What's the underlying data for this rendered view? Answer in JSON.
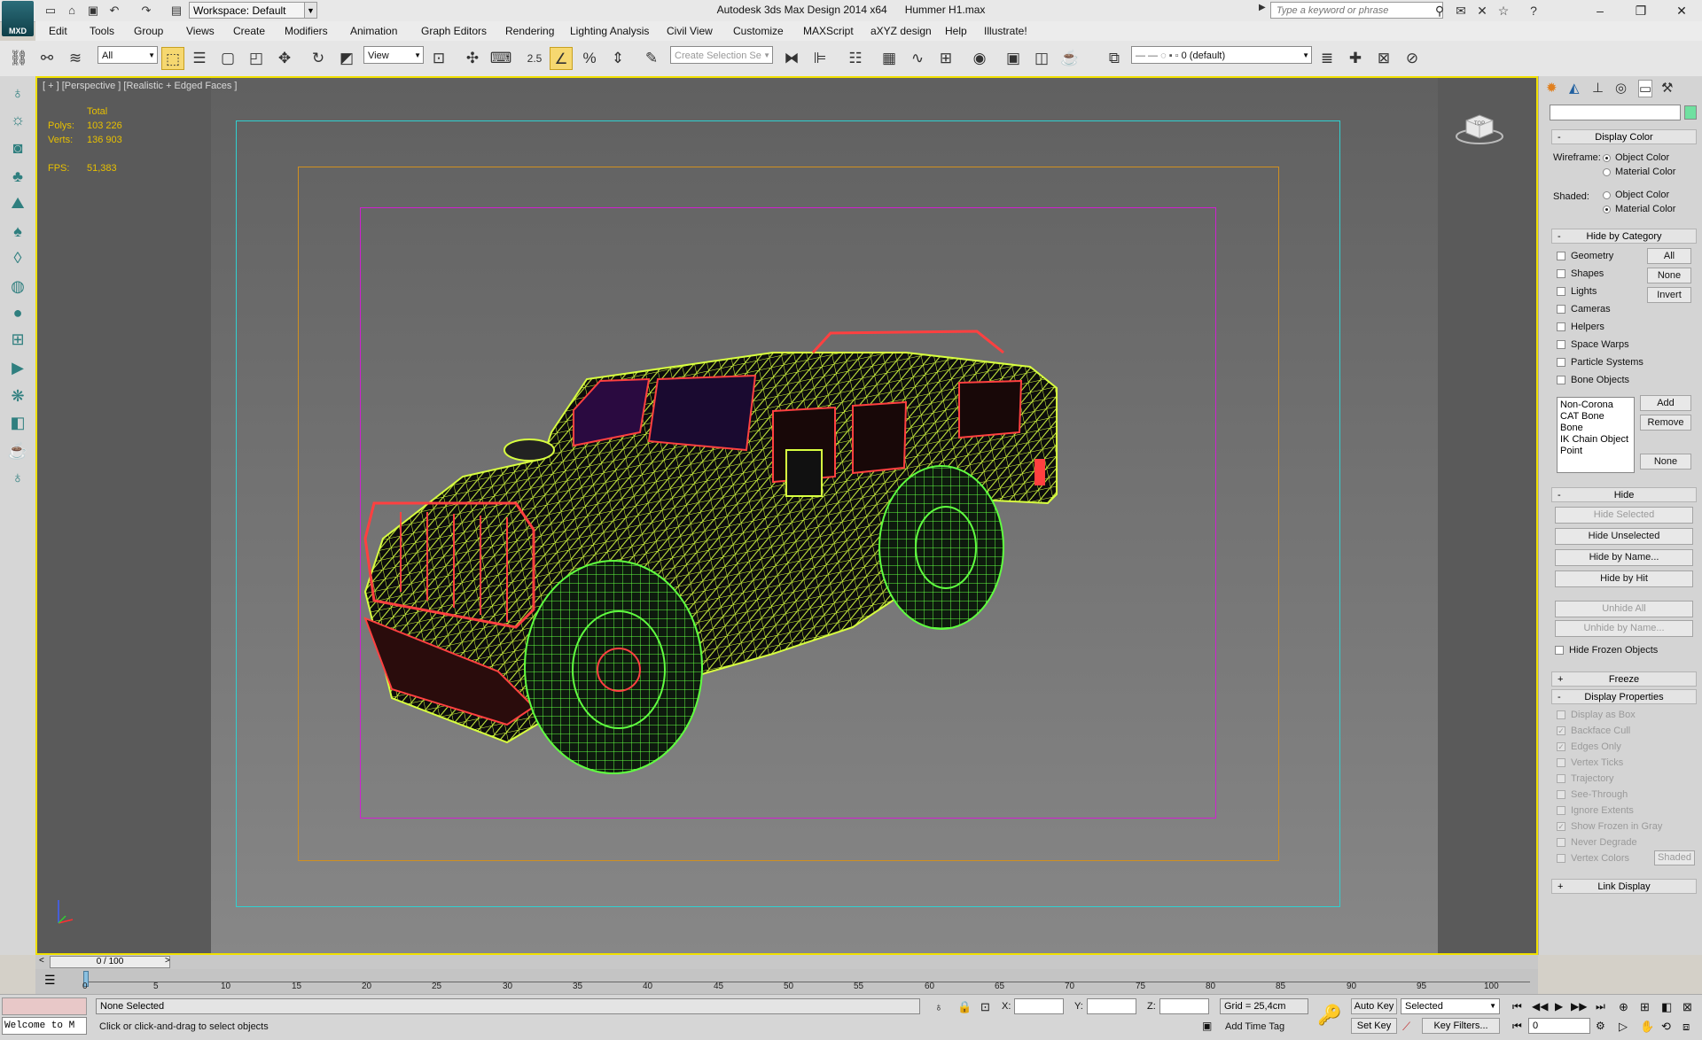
{
  "titlebar": {
    "logo_text": "MXD",
    "workspace_label": "Workspace: Default",
    "app_title": "Autodesk 3ds Max Design 2014 x64      Hummer H1.max",
    "search_placeholder": "Type a keyword or phrase"
  },
  "menus": [
    "Edit",
    "Tools",
    "Group",
    "Views",
    "Create",
    "Modifiers",
    "Animation",
    "Graph Editors",
    "Rendering",
    "Lighting Analysis",
    "Civil View",
    "Customize",
    "MAXScript",
    "aXYZ design",
    "Help",
    "Illustrate!"
  ],
  "toolbar": {
    "selection_filter": "All",
    "ref_coord": "View",
    "snap_value": "2.5",
    "named_selection_placeholder": "Create Selection Se",
    "layer_name": "0 (default)"
  },
  "viewport": {
    "label": "[ + ] [Perspective ] [Realistic + Edged Faces ]",
    "stats": {
      "total_label": "Total",
      "polys_label": "Polys:",
      "polys_value": "103 226",
      "verts_label": "Verts:",
      "verts_value": "136 903",
      "fps_label": "FPS:",
      "fps_value": "51,383"
    },
    "viewcube_text": "TOP"
  },
  "right_panel": {
    "display_color": {
      "header": "Display Color",
      "wireframe_label": "Wireframe:",
      "shaded_label": "Shaded:",
      "opt_object": "Object Color",
      "opt_material": "Material Color"
    },
    "hide_by_category": {
      "header": "Hide by Category",
      "items": [
        "Geometry",
        "Shapes",
        "Lights",
        "Cameras",
        "Helpers",
        "Space Warps",
        "Particle Systems",
        "Bone Objects"
      ],
      "btn_all": "All",
      "btn_none": "None",
      "btn_invert": "Invert",
      "list": [
        "Non-Corona",
        "CAT Bone",
        "Bone",
        "IK Chain Object",
        "Point"
      ],
      "btn_add": "Add",
      "btn_remove": "Remove",
      "btn_none2": "None"
    },
    "hide": {
      "header": "Hide",
      "hide_selected": "Hide Selected",
      "hide_unselected": "Hide Unselected",
      "hide_by_name": "Hide by Name...",
      "hide_by_hit": "Hide by Hit",
      "unhide_all": "Unhide All",
      "unhide_by_name": "Unhide by Name...",
      "hide_frozen": "Hide Frozen Objects"
    },
    "freeze_header": "Freeze",
    "display_properties": {
      "header": "Display Properties",
      "items": [
        "Display as Box",
        "Backface Cull",
        "Edges Only",
        "Vertex Ticks",
        "Trajectory",
        "See-Through",
        "Ignore Extents",
        "Show Frozen in Gray",
        "Never Degrade",
        "Vertex Colors"
      ],
      "checked": [
        false,
        true,
        true,
        false,
        false,
        false,
        false,
        true,
        false,
        false
      ],
      "shaded_btn": "Shaded"
    },
    "link_display_header": "Link Display"
  },
  "timeline": {
    "frame_counter": "0 / 100",
    "ticks": [
      "0",
      "5",
      "10",
      "15",
      "20",
      "25",
      "30",
      "35",
      "40",
      "45",
      "50",
      "55",
      "60",
      "65",
      "70",
      "75",
      "80",
      "85",
      "90",
      "95",
      "100"
    ]
  },
  "statusbar": {
    "listener_text": "Welcome to M",
    "selection_status": "None Selected",
    "prompt": "Click or click-and-drag to select objects",
    "x_label": "X:",
    "y_label": "Y:",
    "z_label": "Z:",
    "grid": "Grid = 25,4cm",
    "add_time_tag": "Add Time Tag",
    "auto_key": "Auto Key",
    "set_key": "Set Key",
    "key_mode": "Selected",
    "key_filters": "Key Filters...",
    "frame_value": "0"
  },
  "colors": {
    "viewport_border": "#f0e000",
    "safe_frame_outer": "#30d0d0",
    "safe_frame_mid": "#d09020",
    "safe_frame_inner": "#d020d0",
    "wire_body": "#d8ff40",
    "wire_trim": "#ff4040",
    "wire_tires": "#60ff40"
  }
}
